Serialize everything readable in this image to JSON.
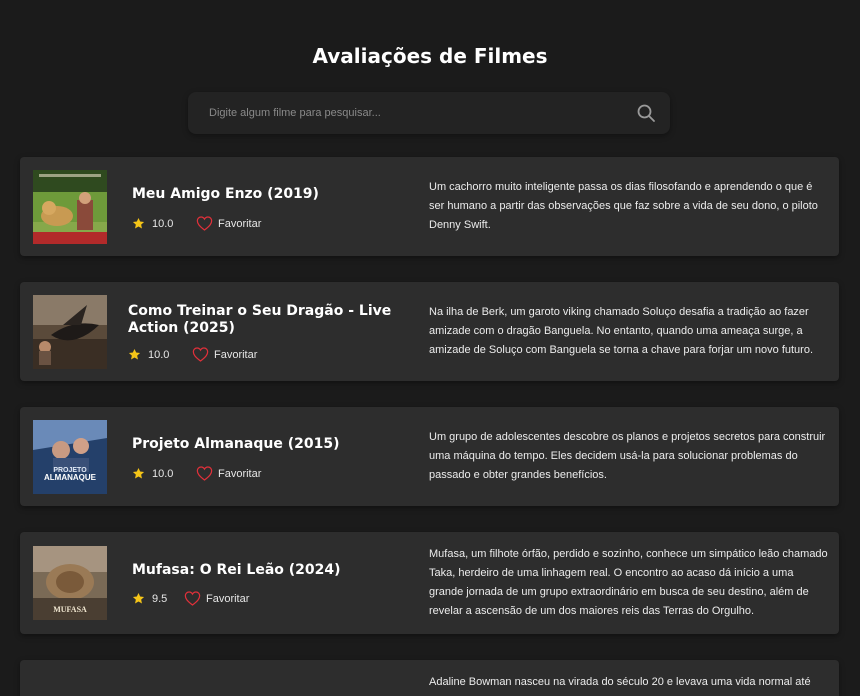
{
  "header": {
    "title": "Avaliações de Filmes"
  },
  "search": {
    "placeholder": "Digite algum filme para pesquisar..."
  },
  "movies": [
    {
      "title": "Meu Amigo Enzo (2019)",
      "rating": "10.0",
      "favorite_label": "Favoritar",
      "description": "Um cachorro muito inteligente passa os dias filosofando e aprendendo o que é ser humano a partir das observações que faz sobre a vida de seu dono, o piloto Denny Swift."
    },
    {
      "title": "Como Treinar o Seu Dragão - Live Action (2025)",
      "rating": "10.0",
      "favorite_label": "Favoritar",
      "description": "Na ilha de Berk, um garoto viking chamado Soluço desafia a tradição ao fazer amizade com o dragão Banguela. No entanto, quando uma ameaça surge, a amizade de Soluço com Banguela se torna a chave para forjar um novo futuro."
    },
    {
      "title": "Projeto Almanaque (2015)",
      "rating": "10.0",
      "favorite_label": "Favoritar",
      "poster_text": [
        "PROJETO",
        "ALMANAQUE"
      ],
      "description": "Um grupo de adolescentes descobre os planos e projetos secretos para construir uma máquina do tempo. Eles decidem usá-la para solucionar problemas do passado e obter grandes benefícios."
    },
    {
      "title": "Mufasa: O Rei Leão (2024)",
      "rating": "9.5",
      "favorite_label": "Favoritar",
      "poster_text": [
        "MUFASA"
      ],
      "description": "Mufasa, um filhote órfão, perdido e sozinho, conhece um simpático leão chamado Taka, herdeiro de uma linhagem real. O encontro ao acaso dá início a uma grande jornada de um grupo extraordinário em busca de seu destino, além de revelar a ascensão de um dos maiores reis das Terras do Orgulho."
    },
    {
      "description": "Adaline Bowman nasceu na virada do século 20 e levava uma vida normal até"
    }
  ],
  "colors": {
    "background": "#1b1b1b",
    "card": "#2d2d2d",
    "star": "#f5c518",
    "heart": "#e0303a"
  },
  "icons": {
    "search": "search-icon",
    "star": "star-icon",
    "heart": "heart-icon"
  }
}
